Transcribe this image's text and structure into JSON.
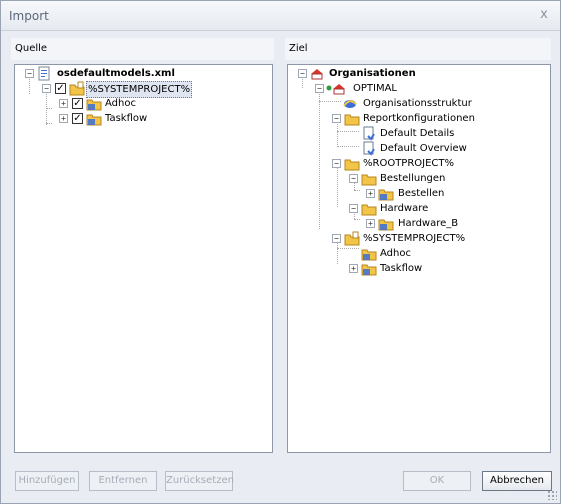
{
  "window": {
    "title": "Import"
  },
  "colors": {
    "folder": "#e8b33a",
    "checkmark": "#000000",
    "accent": "#3a6fd8",
    "selection": "#dfe6f2"
  },
  "source_pane": {
    "header": "Quelle",
    "tree": [
      {
        "label": "osdefaultmodels.xml",
        "icon": "xml-file-icon"
      },
      {
        "label": "%SYSTEMPROJECT%",
        "icon": "project-folder-icon",
        "checked": true
      },
      {
        "label": "Adhoc",
        "icon": "folder-icon",
        "checked": true
      },
      {
        "label": "Taskflow",
        "icon": "folder-icon",
        "checked": true
      }
    ]
  },
  "target_pane": {
    "header": "Ziel",
    "tree": [
      {
        "label": "Organisationen",
        "icon": "organizations-icon"
      },
      {
        "label": "OPTIMAL",
        "icon": "organization-icon"
      },
      {
        "label": "Organisationsstruktur",
        "icon": "structure-icon"
      },
      {
        "label": "Reportkonfigurationen",
        "icon": "folder-icon"
      },
      {
        "label": "Default Details",
        "icon": "report-doc-icon"
      },
      {
        "label": "Default Overview",
        "icon": "report-doc-icon"
      },
      {
        "label": "%ROOTPROJECT%",
        "icon": "folder-icon"
      },
      {
        "label": "Bestellungen",
        "icon": "folder-icon"
      },
      {
        "label": "Bestellen",
        "icon": "folder-icon"
      },
      {
        "label": "Hardware",
        "icon": "folder-icon"
      },
      {
        "label": "Hardware_B",
        "icon": "folder-icon"
      },
      {
        "label": "%SYSTEMPROJECT%",
        "icon": "project-folder-icon"
      },
      {
        "label": "Adhoc",
        "icon": "folder-icon"
      },
      {
        "label": "Taskflow",
        "icon": "folder-icon"
      }
    ]
  },
  "buttons": {
    "add": "Hinzufügen",
    "remove": "Entfernen",
    "reset": "Zurücksetzen",
    "ok": "OK",
    "cancel": "Abbrechen"
  },
  "close_glyph": "x"
}
